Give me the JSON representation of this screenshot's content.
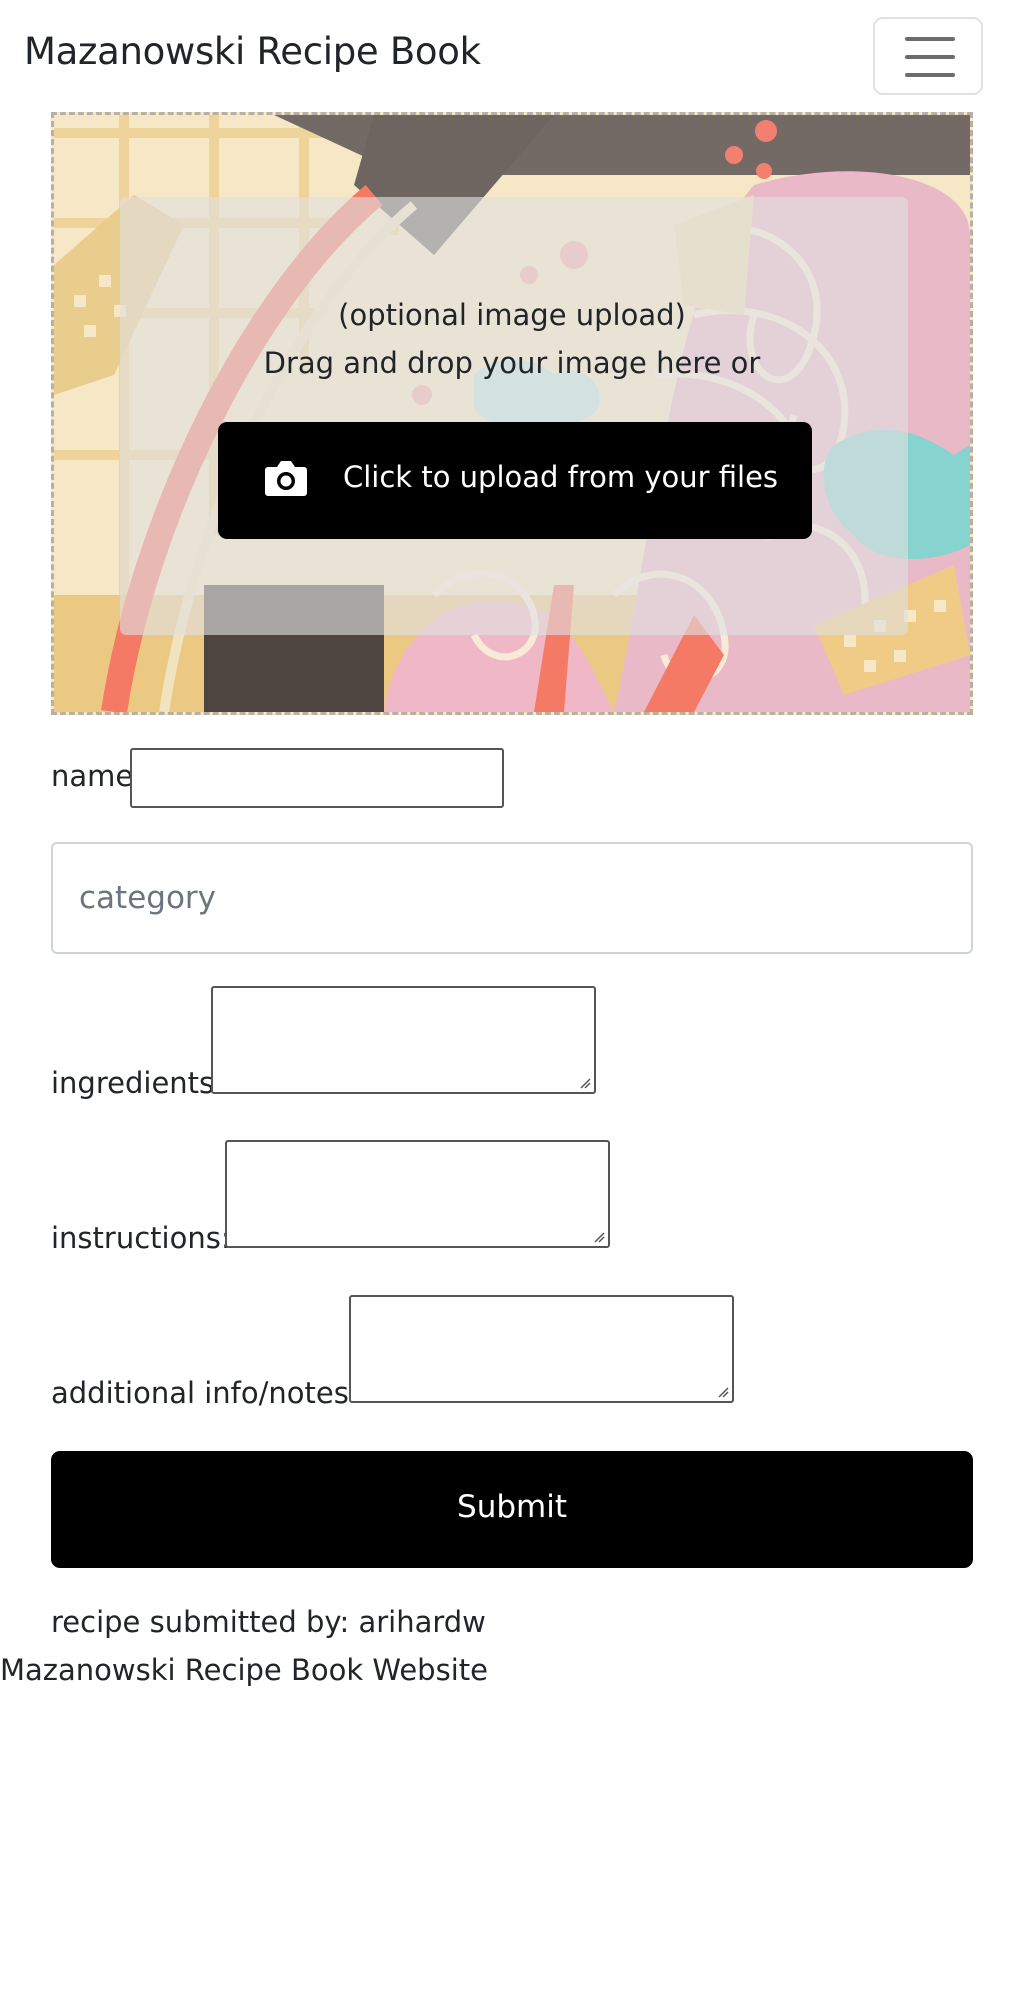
{
  "navbar": {
    "brand": "Mazanowski Recipe Book",
    "toggle_icon": "hamburger-menu-icon"
  },
  "upload": {
    "hint_optional": "(optional image upload)",
    "hint_drag": "Drag and drop your image here or",
    "button_label": "Click to upload from your files",
    "button_icon": "camera-icon"
  },
  "form": {
    "name_label": "name",
    "name_value": "",
    "category_placeholder": "category",
    "ingredients_label": "ingredients",
    "instructions_label": "instructions:",
    "notes_label": "additional info/notes:",
    "submit_label": "Submit"
  },
  "byline": "recipe submitted by: arihardw",
  "footer": "Mazanowski Recipe Book Website",
  "colors": {
    "primary_button": "#000000",
    "input_border": "#ced4da",
    "text": "#212529"
  }
}
